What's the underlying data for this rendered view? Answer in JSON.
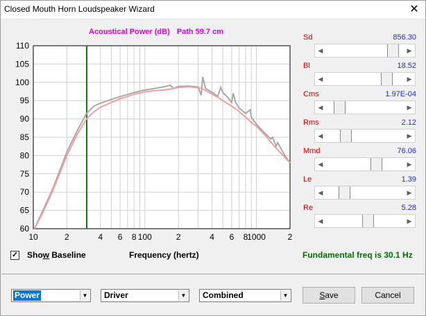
{
  "window": {
    "title": "Closed Mouth Horn Loudspeaker Wizard",
    "close_glyph": "✕"
  },
  "chart": {
    "title_left": "Acoustical Power (dB)",
    "title_right": "Path 59.7 cm"
  },
  "sliders": [
    {
      "label": "Sd",
      "value": "856.30",
      "position": 0.93
    },
    {
      "label": "Bl",
      "value": "18.52",
      "position": 0.83
    },
    {
      "label": "Cms",
      "value": "1.97E-04",
      "position": 0.12
    },
    {
      "label": "Rms",
      "value": "2.12",
      "position": 0.21
    },
    {
      "label": "Mmd",
      "value": "76.06",
      "position": 0.67
    },
    {
      "label": "Le",
      "value": "1.39",
      "position": 0.19
    },
    {
      "label": "Re",
      "value": "5.28",
      "position": 0.55
    }
  ],
  "show_baseline": {
    "label_pre": "Sho",
    "label_u": "w",
    "label_post": " Baseline",
    "checked": "✓"
  },
  "x_axis_label": "Frequency (hertz)",
  "fundamental": "Fundamental freq is 30.1 Hz",
  "dropdowns": {
    "mode": "Power",
    "source": "Driver",
    "combine": "Combined",
    "arrow": "▼"
  },
  "buttons": {
    "save_u": "S",
    "save_rest": "ave",
    "cancel": "Cancel"
  },
  "colors": {
    "current": "#f0a0a0",
    "baseline": "#a8a8a8",
    "marker": "#008000"
  },
  "chart_data": {
    "type": "line",
    "xscale": "log",
    "xlim": [
      10,
      2000
    ],
    "ylim": [
      60,
      110
    ],
    "yticks": [
      "60",
      "65",
      "70",
      "75",
      "80",
      "85",
      "90",
      "95",
      "100",
      "105",
      "110"
    ],
    "xtick_labels": [
      {
        "x": 10,
        "label": "10"
      },
      {
        "x": 20,
        "label": "2"
      },
      {
        "x": 40,
        "label": "4"
      },
      {
        "x": 60,
        "label": "6"
      },
      {
        "x": 80,
        "label": "8"
      },
      {
        "x": 100,
        "label": "100"
      },
      {
        "x": 200,
        "label": "2"
      },
      {
        "x": 400,
        "label": "4"
      },
      {
        "x": 600,
        "label": "6"
      },
      {
        "x": 800,
        "label": "8"
      },
      {
        "x": 1000,
        "label": "1000"
      },
      {
        "x": 2000,
        "label": "2"
      }
    ],
    "marker_x": 30.1,
    "grid": true,
    "series": [
      {
        "x": [
          10.2,
          12,
          15,
          20,
          25,
          30,
          35,
          40,
          50,
          60,
          80,
          100,
          120,
          150,
          180,
          200,
          250,
          300,
          320,
          350,
          400,
          450,
          500,
          600,
          700,
          800,
          900,
          1000,
          1200,
          1500,
          1800,
          2000
        ],
        "y": [
          60,
          64,
          70.5,
          80,
          86,
          90,
          92,
          93.2,
          94.5,
          95.5,
          96.7,
          97.4,
          97.7,
          97.9,
          98.3,
          98.6,
          98.8,
          98.5,
          98.4,
          97.7,
          96.8,
          95.9,
          95,
          93.5,
          92,
          90.5,
          89,
          88,
          85.5,
          82,
          79.5,
          78
        ]
      },
      {
        "x": [
          10.2,
          12,
          15,
          20,
          25,
          30,
          35,
          40,
          50,
          60,
          80,
          100,
          120,
          150,
          170,
          180,
          200,
          250,
          300,
          320,
          330,
          350,
          400,
          450,
          480,
          500,
          550,
          600,
          620,
          650,
          700,
          800,
          880,
          900,
          1000,
          1200,
          1350,
          1400,
          1500,
          1550,
          1800,
          2000
        ],
        "y": [
          60,
          64.5,
          71,
          81,
          87,
          91.5,
          93.5,
          94.3,
          95.3,
          96.1,
          97.2,
          97.9,
          98.3,
          98.8,
          99.2,
          98.3,
          98.9,
          99,
          98.7,
          96.5,
          101.5,
          98.3,
          97.3,
          96.2,
          98.6,
          97.2,
          96,
          94.5,
          97,
          94.5,
          93,
          91.5,
          92.5,
          90.5,
          88.5,
          86,
          84.5,
          85,
          82.5,
          83.5,
          80,
          78
        ]
      }
    ]
  }
}
